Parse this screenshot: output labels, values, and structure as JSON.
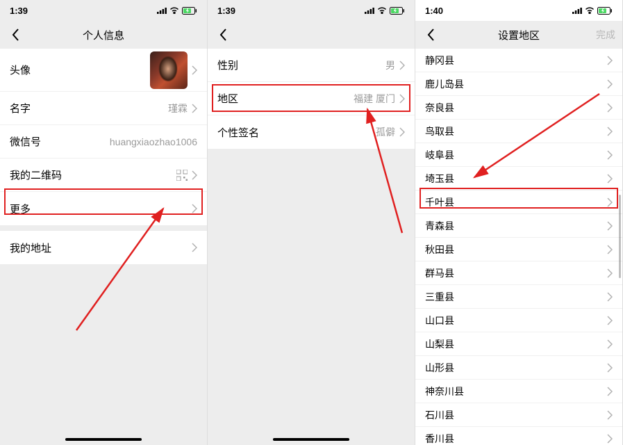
{
  "screen1": {
    "statusbar": {
      "time": "1:39"
    },
    "header": {
      "title": "个人信息"
    },
    "rows": {
      "avatar": {
        "label": "头像"
      },
      "name": {
        "label": "名字",
        "value": "瑾霖"
      },
      "wxid": {
        "label": "微信号",
        "value": "huangxiaozhao1006"
      },
      "qrcode": {
        "label": "我的二维码"
      },
      "more": {
        "label": "更多"
      },
      "address": {
        "label": "我的地址"
      }
    }
  },
  "screen2": {
    "statusbar": {
      "time": "1:39"
    },
    "rows": {
      "gender": {
        "label": "性别",
        "value": "男"
      },
      "region": {
        "label": "地区",
        "value": "福建 厦门"
      },
      "bio": {
        "label": "个性签名",
        "value": "孤僻"
      }
    }
  },
  "screen3": {
    "statusbar": {
      "time": "1:40"
    },
    "header": {
      "title": "设置地区",
      "done": "完成"
    },
    "regions": [
      "静冈县",
      "鹿儿岛县",
      "奈良县",
      "鸟取县",
      "岐阜县",
      "埼玉县",
      "千叶县",
      "青森县",
      "秋田县",
      "群马县",
      "三重县",
      "山口县",
      "山梨县",
      "山形县",
      "神奈川县",
      "石川县",
      "香川县"
    ]
  }
}
